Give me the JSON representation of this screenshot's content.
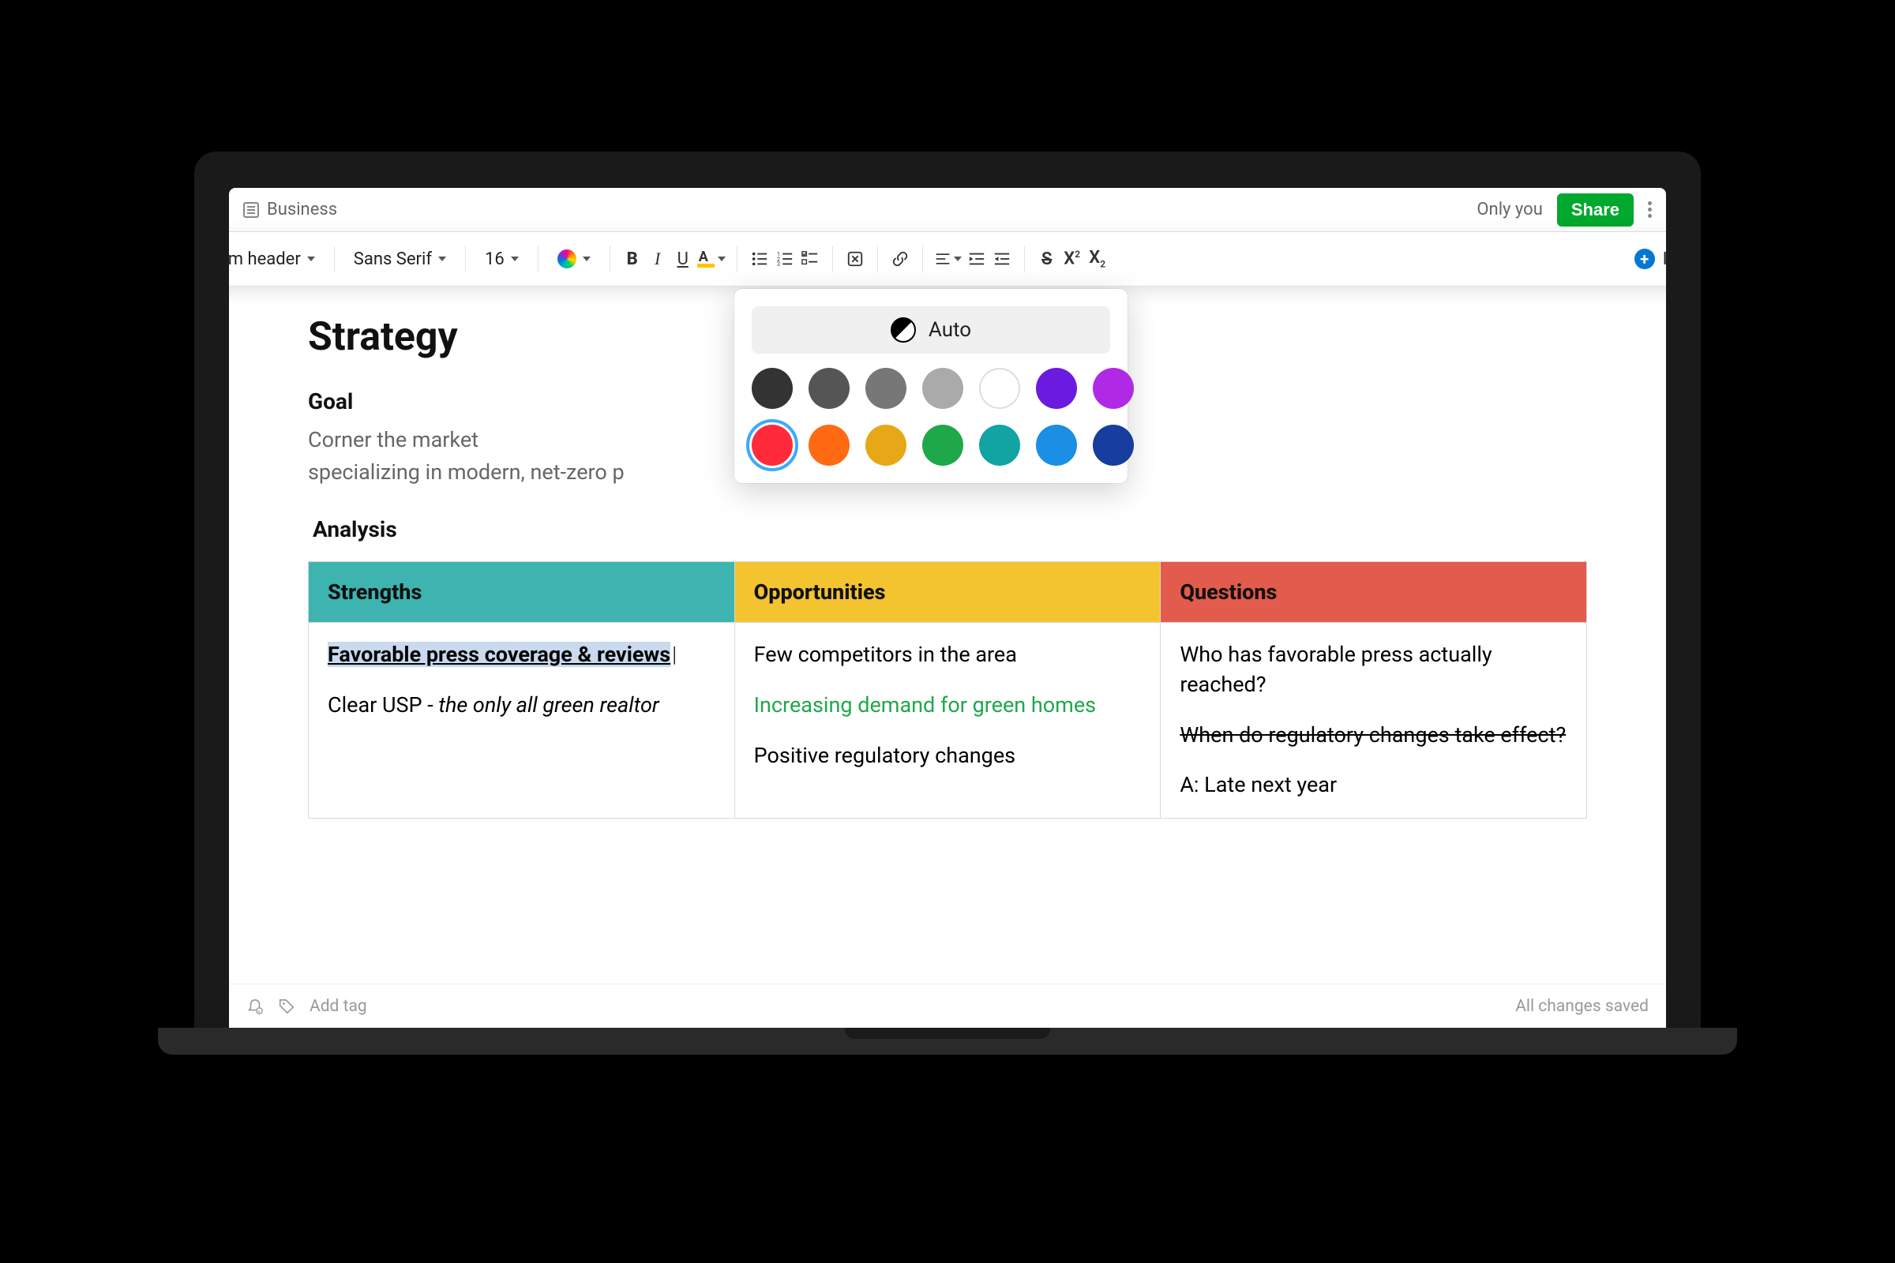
{
  "topbar": {
    "breadcrumb": "Business",
    "visibility": "Only you",
    "share_label": "Share"
  },
  "toolbar": {
    "style_dropdown": "Medium header",
    "font_dropdown": "Sans Serif",
    "size_dropdown": "16",
    "insert_label": "Insert"
  },
  "color_panel": {
    "auto_label": "Auto",
    "row1": [
      "#333333",
      "#555555",
      "#777777",
      "#aaaaaa",
      "#ffffff",
      "#6b1be0",
      "#b02ae6"
    ],
    "row2": [
      "#ff2b3a",
      "#ff6a13",
      "#e6a817",
      "#1fa84a",
      "#12a3a3",
      "#1a8fe3",
      "#173e9e"
    ],
    "selected_index_row2": 0
  },
  "document": {
    "title": "Strategy",
    "goal_heading": "Goal",
    "goal_body": "Corner the market _____________________________ by specializing in modern, net-zero p",
    "analysis_heading": "Analysis",
    "table": {
      "headers": {
        "strengths": "Strengths",
        "opportunities": "Opportunities",
        "questions": "Questions"
      },
      "strengths": {
        "p1_selected": "Favorable press coverage & reviews",
        "p2_prefix": "Clear USP - ",
        "p2_italic": "the only all green realtor"
      },
      "opportunities": {
        "p1": "Few competitors in the area",
        "p2_green": "Increasing demand for green homes",
        "p3": "Positive regulatory changes"
      },
      "questions": {
        "p1": "Who has favorable press actually reached?",
        "p2_strike": "When do regulatory changes take effect?",
        "p3": "A: Late next year"
      }
    }
  },
  "bottombar": {
    "add_tag": "Add tag",
    "save_status": "All changes saved"
  }
}
